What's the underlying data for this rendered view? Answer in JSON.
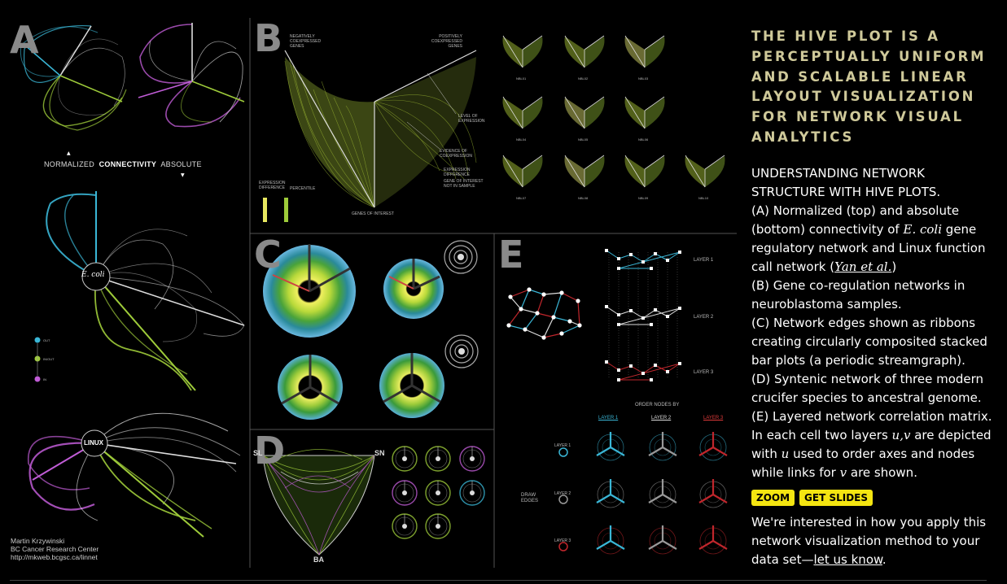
{
  "figure": {
    "panel_labels": [
      "A",
      "B",
      "C",
      "D",
      "E"
    ],
    "panel_a": {
      "normalized": "NORMALIZED",
      "connectivity": "CONNECTIVITY",
      "absolute": "ABSOLUTE",
      "ecoli": "E. coli",
      "linux": "LINUX",
      "legend": [
        "OUT",
        "IN/OUT",
        "IN"
      ],
      "credit": [
        "Martin Krzywinski",
        "BC Cancer Research Center",
        "http://mkweb.bcgsc.ca/linnet"
      ]
    },
    "panel_b": {
      "negatively": "NEGATIVELY COEXPRESSED GENES",
      "positively": "POSITIVELY COEXPRESSED GENES",
      "level": "LEVEL OF EXPRESSION",
      "evidence": "EVIDENCE OF COEXPRESSION",
      "genes_of_interest": "GENES OF INTEREST",
      "expression_difference": "EXPRESSION DIFFERENCE",
      "percentile": "PERCENTILE",
      "expr_diff_key": "EXPRESSION DIFFERENCE",
      "gene_not_in_sample": "GENE OF INTEREST NOT IN SAMPLE",
      "samples": [
        "NBL01",
        "NBL02",
        "NBL03",
        "NBL04",
        "NBL05",
        "NBL06",
        "NBL07",
        "NBL08",
        "NBL09",
        "NBL10"
      ]
    },
    "panel_d": {
      "sl": "SL",
      "sn": "SN",
      "ba": "BA"
    },
    "panel_e": {
      "layers": [
        "LAYER 1",
        "LAYER 2",
        "LAYER 3"
      ],
      "order_nodes_by": "ORDER NODES BY",
      "draw_edges": "DRAW EDGES",
      "matrix_cols": [
        "LAYER 1",
        "LAYER 2",
        "LAYER 3"
      ],
      "matrix_rows": [
        "LAYER 1",
        "LAYER 2",
        "LAYER 3"
      ]
    }
  },
  "sidebar": {
    "headline": "THE HIVE PLOT IS A PERCEPTUALLY UNIFORM AND SCALABLE LINEAR LAYOUT VISUALIZATION FOR NETWORK VISUAL ANALYTICS",
    "caption": {
      "title": "UNDERSTANDING NETWORK STRUCTURE WITH HIVE PLOTS.",
      "a_pre": "(A) Normalized (top) and absolute (bottom) connectivity of",
      "a_species": "E. coli",
      "a_post": "gene regulatory network and Linux function call network (",
      "a_link": "Yan et al.",
      "a_close": ")",
      "b": "(B) Gene co-regulation networks in neuroblastoma samples.",
      "c": "(C) Network edges shown as ribbons creating circularly composited stacked bar plots (a periodic streamgraph).",
      "d": "(D) Syntenic network of three modern crucifer species to ancestral genome.",
      "e_pre": "(E) Layered network correlation matrix. In each cell two layers",
      "e_uv": "u,v",
      "e_mid1": "are depicted with",
      "e_u": "u",
      "e_mid2": "used to order axes and nodes while links for",
      "e_v": "v",
      "e_post": "are shown."
    },
    "buttons": {
      "zoom": "ZOOM",
      "slides": "GET SLIDES"
    },
    "outro_pre": "We're interested in how you apply this network visualization method to your data set—",
    "outro_link": "let us know",
    "outro_post": "."
  },
  "colors": {
    "headline": "#cfc99a",
    "button": "#f4e511",
    "cyan": "#3ab6d6",
    "green": "#9ecb3a",
    "magenta": "#c05cd6",
    "red": "#c0262c"
  }
}
